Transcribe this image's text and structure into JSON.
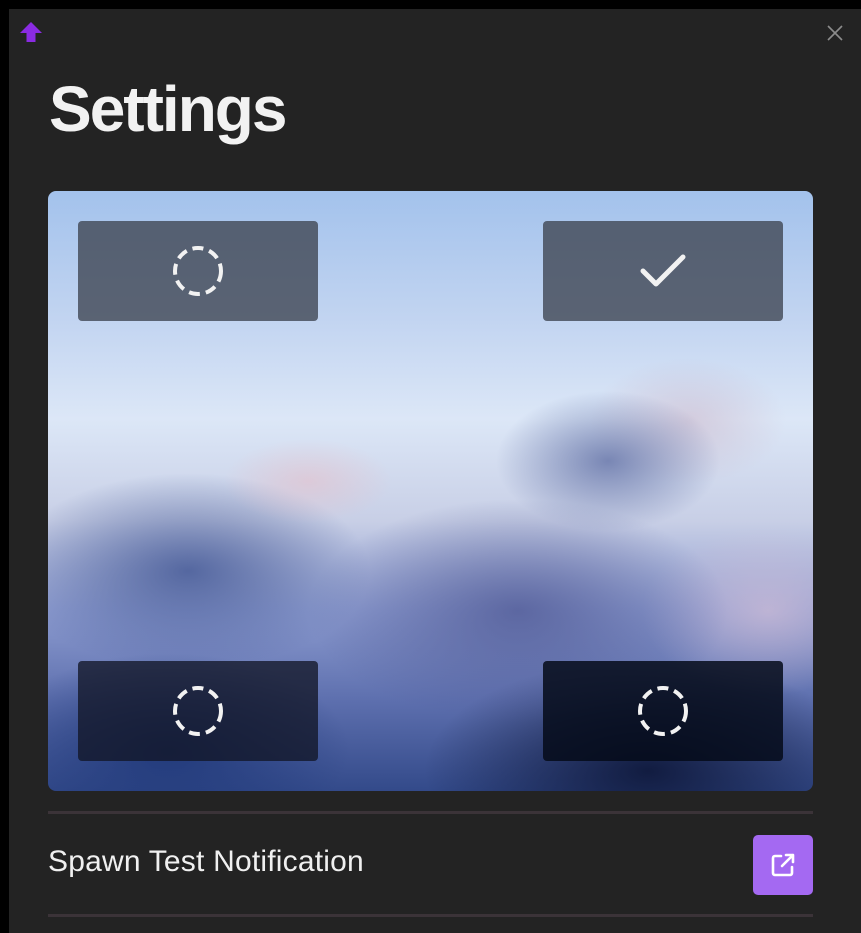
{
  "window": {
    "logo_icon": "arrow-up-icon",
    "logo_color": "#8a2be2",
    "close_icon": "close-icon"
  },
  "page": {
    "title": "Settings"
  },
  "position_picker": {
    "corners": [
      {
        "id": "top-left",
        "state": "unselected",
        "icon": "dashed-circle-icon"
      },
      {
        "id": "top-right",
        "state": "selected",
        "icon": "checkmark-icon"
      },
      {
        "id": "bottom-left",
        "state": "unselected",
        "icon": "dashed-circle-icon"
      },
      {
        "id": "bottom-right",
        "state": "unselected",
        "icon": "dashed-circle-icon"
      }
    ]
  },
  "actions": {
    "spawn_label": "Spawn Test Notification",
    "spawn_icon": "external-link-icon",
    "accent_color": "#a469f2"
  }
}
